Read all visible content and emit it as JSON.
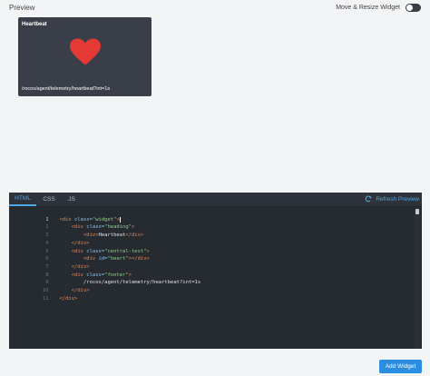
{
  "preview": {
    "label": "Preview",
    "move_resize_label": "Move & Resize Widget",
    "toggle_on": false,
    "widget": {
      "heading": "Heartbeat",
      "footer": "/rocos/agent/telemetry/heartbeat?int=1s",
      "heart_color": "#e53935",
      "background": "#3a3e48"
    }
  },
  "editor": {
    "tabs": [
      {
        "label": "HTML",
        "active": true
      },
      {
        "label": "CSS",
        "active": false
      },
      {
        "label": "JS",
        "active": false
      }
    ],
    "refresh_label": "Refresh Preview",
    "lines": [
      {
        "n": "1",
        "indent": "",
        "tag_open": "<div",
        "attr": " class=",
        "str": "\"widget\"",
        "tag_close": ">",
        "text": "",
        "end": ""
      },
      {
        "n": "2",
        "indent": "    ",
        "tag_open": "<div",
        "attr": " class=",
        "str": "\"heading\"",
        "tag_close": ">",
        "text": "",
        "end": ""
      },
      {
        "n": "3",
        "indent": "        ",
        "tag_open": "<div",
        "attr": "",
        "str": "",
        "tag_close": ">",
        "text": "Heartbeat",
        "end": "</div>"
      },
      {
        "n": "4",
        "indent": "    ",
        "tag_open": "</div>",
        "attr": "",
        "str": "",
        "tag_close": "",
        "text": "",
        "end": ""
      },
      {
        "n": "5",
        "indent": "    ",
        "tag_open": "<div",
        "attr": " class=",
        "str": "\"central-text\"",
        "tag_close": ">",
        "text": "",
        "end": ""
      },
      {
        "n": "6",
        "indent": "        ",
        "tag_open": "<div",
        "attr": " id=",
        "str": "\"heart\"",
        "tag_close": ">",
        "text": "",
        "end": "</div>"
      },
      {
        "n": "7",
        "indent": "    ",
        "tag_open": "</div>",
        "attr": "",
        "str": "",
        "tag_close": "",
        "text": "",
        "end": ""
      },
      {
        "n": "8",
        "indent": "    ",
        "tag_open": "<div",
        "attr": " class=",
        "str": "\"footer\"",
        "tag_close": ">",
        "text": "",
        "end": ""
      },
      {
        "n": "9",
        "indent": "        ",
        "tag_open": "",
        "attr": "",
        "str": "",
        "tag_close": "",
        "text": "/rocos/agent/telemetry/heartbeat?int=1s",
        "end": ""
      },
      {
        "n": "10",
        "indent": "    ",
        "tag_open": "</div>",
        "attr": "",
        "str": "",
        "tag_close": "",
        "text": "",
        "end": ""
      },
      {
        "n": "11",
        "indent": "",
        "tag_open": "</div>",
        "attr": "",
        "str": "",
        "tag_close": "",
        "text": "",
        "end": ""
      }
    ]
  },
  "actions": {
    "add_widget_label": "Add Widget"
  },
  "colors": {
    "accent": "#2b8de0",
    "editor_bg": "#262a31",
    "tag": "#e28a5a",
    "attribute": "#8fc3e8",
    "string": "#8fd28c"
  }
}
